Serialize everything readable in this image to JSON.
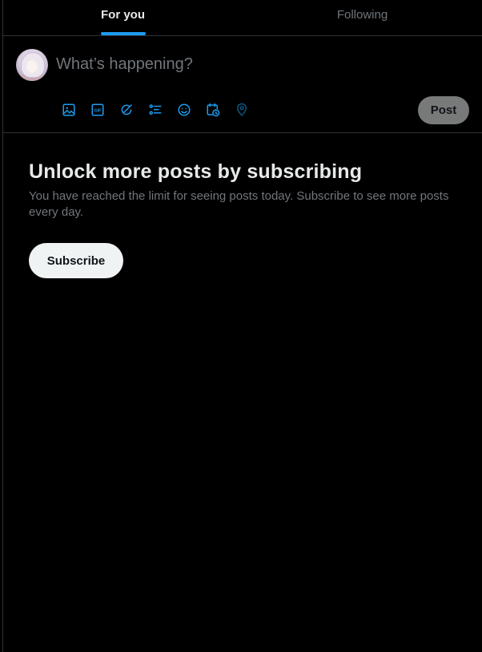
{
  "tabs": [
    {
      "label": "For you",
      "active": true
    },
    {
      "label": "Following",
      "active": false
    }
  ],
  "composer": {
    "placeholder": "What’s happening?",
    "post_label": "Post",
    "tools": [
      {
        "icon": "image-icon"
      },
      {
        "icon": "gif-icon",
        "text": "GIF"
      },
      {
        "icon": "grok-icon"
      },
      {
        "icon": "poll-icon"
      },
      {
        "icon": "emoji-icon"
      },
      {
        "icon": "schedule-icon"
      },
      {
        "icon": "location-icon",
        "disabled": true
      }
    ]
  },
  "paywall": {
    "title": "Unlock more posts by subscribing",
    "description": "You have reached the limit for seeing posts today. Subscribe to see more posts every day.",
    "button_label": "Subscribe"
  },
  "colors": {
    "background": "#000000",
    "accent": "#1d9bf0",
    "text_primary": "#e7e9ea",
    "text_secondary": "#71767b",
    "border": "#2f3336",
    "post_button_bg": "#787a7a",
    "subscribe_button_bg": "#eff3f4"
  }
}
